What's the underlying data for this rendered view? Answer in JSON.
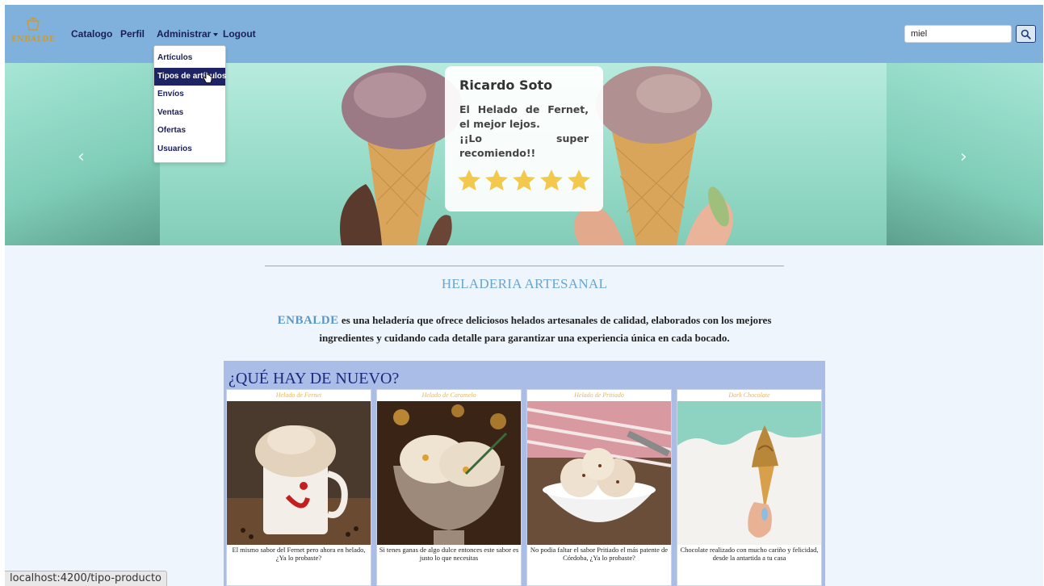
{
  "navbar": {
    "brand": "ENBALDE",
    "links": {
      "catalogo": "Catalogo",
      "perfil": "Perfil",
      "administrar": "Administrar",
      "logout": "Logout"
    },
    "search": {
      "value": "miel",
      "icon": "search-icon"
    }
  },
  "dropdown": {
    "items": [
      "Artículos",
      "Tipos de artículos",
      "Envíos",
      "Ventas",
      "Ofertas",
      "Usuarios"
    ],
    "active_index": 1
  },
  "carousel": {
    "review": {
      "name": "Ricardo Soto",
      "text_line1": "El Helado de Fernet, el mejor lejos.",
      "text_line2": "¡¡Lo super recomiendo!!",
      "stars": 5
    },
    "prev_icon": "chevron-left-icon",
    "next_icon": "chevron-right-icon"
  },
  "about": {
    "title": "HELADERIA ARTESANAL",
    "brand_word": "ENBALDE",
    "text": "es una heladería que ofrece deliciosos helados artesanales de calidad, elaborados con los mejores ingredientes y cuidando cada detalle para garantizar una experiencia única en cada bocado."
  },
  "news": {
    "title": "¿QUÉ HAY DE NUEVO?",
    "cards": [
      {
        "title": "Helado de Fernet",
        "desc": "El mismo sabor del Fernet pero ahora en helado, ¿Ya lo probaste?"
      },
      {
        "title": "Helado de Caramelo",
        "desc": "Si tenes ganas de algo dulce entonces este sabor es justo lo que necesitas"
      },
      {
        "title": "Helado de Pritiado",
        "desc": "No podia faltar el sabor Pritiado el más patente de Córdoba, ¿Ya lo probaste?"
      },
      {
        "title": "Dark Chocolate",
        "desc": "Chocolate realizado con mucho cariño y felicidad, desde la antartida a tu casa"
      }
    ]
  },
  "status_bar": {
    "url": "localhost:4200/tipo-producto"
  },
  "colors": {
    "navbar": "#7fb1dc",
    "accent": "#1d2364",
    "news_bg": "#a9bde6",
    "star": "#f2c94c"
  }
}
